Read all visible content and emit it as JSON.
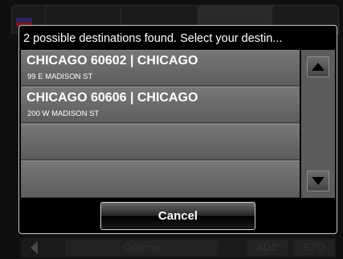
{
  "dialog": {
    "title": "2 possible destinations found. Select your destin...",
    "results": [
      {
        "title": "CHICAGO 60602  | CHICAGO",
        "address": "99 E MADISON ST"
      },
      {
        "title": "CHICAGO 60606  | CHICAGO",
        "address": "200 W MADISON ST"
      }
    ],
    "cancel_label": "Cancel",
    "scroll_up_icon": "triangle-up-icon",
    "scroll_down_icon": "triangle-down-icon"
  },
  "background": {
    "bottom_bar": {
      "slot1": "Options",
      "slot2": "ADC",
      "slot3": "STO"
    }
  },
  "colors": {
    "list_item": "#6c6c6c",
    "scrollbar": "#5c5c5c",
    "dialog_background": "#000000",
    "dialog_border": "#c9c9c9"
  }
}
